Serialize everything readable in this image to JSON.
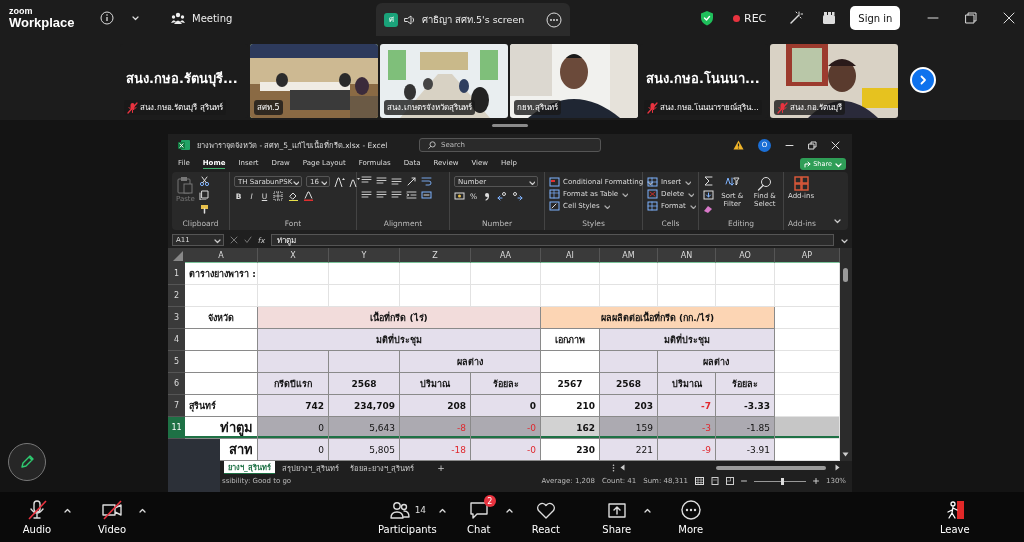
{
  "top_bar": {
    "logo_top": "zoom",
    "logo_bottom": "Workplace",
    "meeting_label": "Meeting",
    "share_tab": {
      "initial": "ศ",
      "title": "ศาธิญา สศท.5's screen"
    },
    "rec_label": "REC",
    "sign_in": "Sign in"
  },
  "participant_strip": {
    "tiles": [
      {
        "kind": "name",
        "name": "สนง.กษอ.รัตนบุรี...",
        "label": "สนง.กษอ.รัตนบุรี สุรินทร์",
        "muted": true,
        "selected": false
      },
      {
        "kind": "video",
        "label": "สศท.5",
        "muted": false,
        "selected": true
      },
      {
        "kind": "video",
        "label": "สนง.เกษตรจังหวัดสุรินทร์",
        "muted": false,
        "selected": false
      },
      {
        "kind": "video",
        "label": "กยท.สุรินทร์",
        "muted": false,
        "selected": false
      },
      {
        "kind": "name",
        "name": "สนง.กษอ.โนนนา...",
        "label": "สนง.กษอ.โนนนารายณ์สุริน...",
        "muted": true,
        "selected": false
      },
      {
        "kind": "video",
        "label": "สนง.กอ.รัตนบุรี",
        "muted": true,
        "selected": false
      }
    ]
  },
  "excel": {
    "title": "ยางพาราจุดจังหวัด - สศท_5_แก้ไขเนื้อที่กรีด.xlsx - Excel",
    "search_placeholder": "Search",
    "account_initial": "O",
    "menu": [
      {
        "label": "File",
        "selected": false
      },
      {
        "label": "Home",
        "selected": true
      },
      {
        "label": "Insert",
        "selected": false
      },
      {
        "label": "Draw",
        "selected": false
      },
      {
        "label": "Page Layout",
        "selected": false
      },
      {
        "label": "Formulas",
        "selected": false
      },
      {
        "label": "Data",
        "selected": false
      },
      {
        "label": "Review",
        "selected": false
      },
      {
        "label": "View",
        "selected": false
      },
      {
        "label": "Help",
        "selected": false
      }
    ],
    "share": "Share",
    "ribbon": [
      {
        "kind": "clipboard",
        "title": "Clipboard",
        "paste": {
          "label": "Paste",
          "disabled": true
        }
      },
      {
        "kind": "font",
        "title": "Font",
        "font_name": "TH SarabunPSK",
        "font_size": "16",
        "bold": "B",
        "italic": "I",
        "underline": "U"
      },
      {
        "kind": "alignment",
        "title": "Alignment"
      },
      {
        "kind": "number",
        "title": "Number",
        "format": "Number",
        "percent": "%"
      },
      {
        "kind": "styles",
        "title": "Styles",
        "items": [
          "Conditional Formatting",
          "Format as Table",
          "Cell Styles"
        ]
      },
      {
        "kind": "cells",
        "title": "Cells",
        "items": [
          "Insert",
          "Delete",
          "Format"
        ]
      },
      {
        "kind": "editing",
        "title": "Editing",
        "items": [
          "Sort & Filter",
          "Find & Select"
        ]
      },
      {
        "kind": "addins",
        "title": "Add-ins",
        "label": "Add-ins"
      }
    ],
    "name_box": "A11",
    "function_label": "fx",
    "formula": "ท่าตูม",
    "columns": [
      "A",
      "X",
      "Y",
      "Z",
      "AA",
      "AI",
      "AM",
      "AN",
      "AO",
      "AP"
    ],
    "rows": [
      {
        "num": "1",
        "kind": "title",
        "selected": false,
        "cells": [
          {
            "text": "ตารางยางพารา :"
          },
          "",
          "",
          "",
          "",
          "",
          "",
          "",
          "",
          ""
        ]
      },
      {
        "num": "2",
        "kind": "blank",
        "selected": false,
        "cells": [
          "",
          "",
          "",
          "",
          "",
          "",
          "",
          "",
          "",
          ""
        ]
      },
      {
        "num": "3",
        "kind": "header",
        "selected": false,
        "cells": [
          {
            "text": "จังหวัด"
          },
          {
            "text": "เนื้อที่กรีด (ไร่)",
            "color": "#f2dcdb",
            "colspan": 4
          },
          {
            "text": "ผลผลิตต่อเนื้อที่กรีด (กก./ไร่)",
            "color": "#fcd5b4",
            "colspan": 4
          },
          ""
        ]
      },
      {
        "num": "4",
        "kind": "header",
        "selected": false,
        "cells": [
          "",
          {
            "text": "มติที่ประชุม",
            "color": "#e4dfec",
            "colspan": 4
          },
          {
            "text": "เอกภาพ"
          },
          {
            "text": "มติที่ประชุม",
            "color": "#e4dfec",
            "colspan": 3
          },
          ""
        ]
      },
      {
        "num": "5",
        "kind": "header",
        "selected": false,
        "cells": [
          "",
          {
            "color": "#e4dfec"
          },
          {
            "color": "#e4dfec"
          },
          {
            "text": "ผลต่าง",
            "color": "#e4dfec",
            "colspan": 2
          },
          "",
          {
            "color": "#e4dfec"
          },
          {
            "text": "ผลต่าง",
            "color": "#e4dfec",
            "colspan": 2
          },
          ""
        ]
      },
      {
        "num": "6",
        "kind": "header",
        "selected": false,
        "cells": [
          "",
          {
            "text": "กรีดปีแรก",
            "color": "#e4dfec"
          },
          {
            "text": "2568",
            "color": "#e4dfec"
          },
          {
            "text": "ปริมาณ",
            "color": "#e4dfec"
          },
          {
            "text": "ร้อยละ",
            "color": "#e4dfec"
          },
          {
            "text": "2567"
          },
          {
            "text": "2568",
            "color": "#e4dfec"
          },
          {
            "text": "ปริมาณ",
            "color": "#e4dfec"
          },
          {
            "text": "ร้อยละ",
            "color": "#e4dfec"
          },
          ""
        ]
      },
      {
        "num": "7",
        "kind": "province",
        "selected": false,
        "cells": [
          {
            "text": "สุรินทร์",
            "negative": false
          },
          {
            "text": "742",
            "color": "#e4dfec",
            "negative": false
          },
          {
            "text": "234,709",
            "color": "#e4dfec",
            "negative": false
          },
          {
            "text": "208",
            "color": "#e4dfec",
            "negative": false
          },
          {
            "text": "0",
            "color": "#e4dfec",
            "negative": false
          },
          {
            "text": "210",
            "negative": false
          },
          {
            "text": "203",
            "color": "#e4dfec",
            "negative": false
          },
          {
            "text": "-7",
            "color": "#e4dfec",
            "negative": true
          },
          {
            "text": "-3.33",
            "color": "#e4dfec",
            "negative": false
          },
          ""
        ]
      },
      {
        "num": "11",
        "kind": "district",
        "selected": true,
        "cells": [
          {
            "text": "ท่าตูม",
            "negative": false
          },
          {
            "text": "0",
            "color": "#acaab1",
            "negative": false
          },
          {
            "text": "5,643",
            "color": "#acaab1",
            "negative": false
          },
          {
            "text": "-8",
            "color": "#acaab1",
            "negative": true
          },
          {
            "text": "-0",
            "color": "#acaab1",
            "negative": true
          },
          {
            "text": "162",
            "color": "#d2d2d2",
            "negative": false
          },
          {
            "text": "159",
            "color": "#acaab1",
            "negative": false
          },
          {
            "text": "-3",
            "color": "#acaab1",
            "negative": true
          },
          {
            "text": "-1.85",
            "color": "#acaab1",
            "negative": false
          },
          {
            "color": "#c6c6c6"
          }
        ]
      },
      {
        "kind": "district",
        "selected": false,
        "cells": [
          {
            "text": "สาท",
            "negative": false
          },
          {
            "text": "0",
            "color": "#e4dfec",
            "negative": false
          },
          {
            "text": "5,805",
            "color": "#e4dfec",
            "negative": false
          },
          {
            "text": "-18",
            "color": "#e4dfec",
            "negative": true
          },
          {
            "text": "-0",
            "color": "#e4dfec",
            "negative": true
          },
          {
            "text": "230",
            "negative": false
          },
          {
            "text": "221",
            "color": "#e4dfec",
            "negative": false
          },
          {
            "text": "-9",
            "color": "#e4dfec",
            "negative": true
          },
          {
            "text": "-3.91",
            "color": "#e4dfec",
            "negative": false
          },
          ""
        ]
      }
    ],
    "sheet_tabs": [
      {
        "label": "ยางฯ_สุรินทร์",
        "selected": true
      },
      {
        "label": "สรุปยางฯ_สุรินทร์",
        "selected": false
      },
      {
        "label": "ร้อยละยางฯ_สุรินทร์",
        "selected": false
      }
    ],
    "add_sheet": "+",
    "status": {
      "message": "ssibility: Good to go",
      "average": "Average: 1,208",
      "count": "Count: 41",
      "sum": "Sum: 48,311",
      "zoom_slider": {
        "level": 0.55
      },
      "zoom_percent": "130%"
    }
  },
  "meeting_controls": {
    "items": [
      {
        "kind": "audio",
        "label": "Audio",
        "off": true,
        "has_menu": true
      },
      {
        "kind": "video",
        "label": "Video",
        "off": true,
        "has_menu": true
      },
      {
        "kind": "participants",
        "label": "Participants",
        "count": "14",
        "off": false,
        "has_menu": true
      },
      {
        "kind": "chat",
        "label": "Chat",
        "badge": "2",
        "off": false,
        "has_menu": true
      },
      {
        "kind": "react",
        "label": "React",
        "off": false,
        "has_menu": false
      },
      {
        "kind": "share",
        "label": "Share",
        "off": false,
        "has_menu": true
      },
      {
        "kind": "more",
        "label": "More",
        "off": false,
        "has_menu": false
      },
      {
        "kind": "leave",
        "label": "Leave",
        "off": false,
        "has_menu": false
      }
    ]
  }
}
